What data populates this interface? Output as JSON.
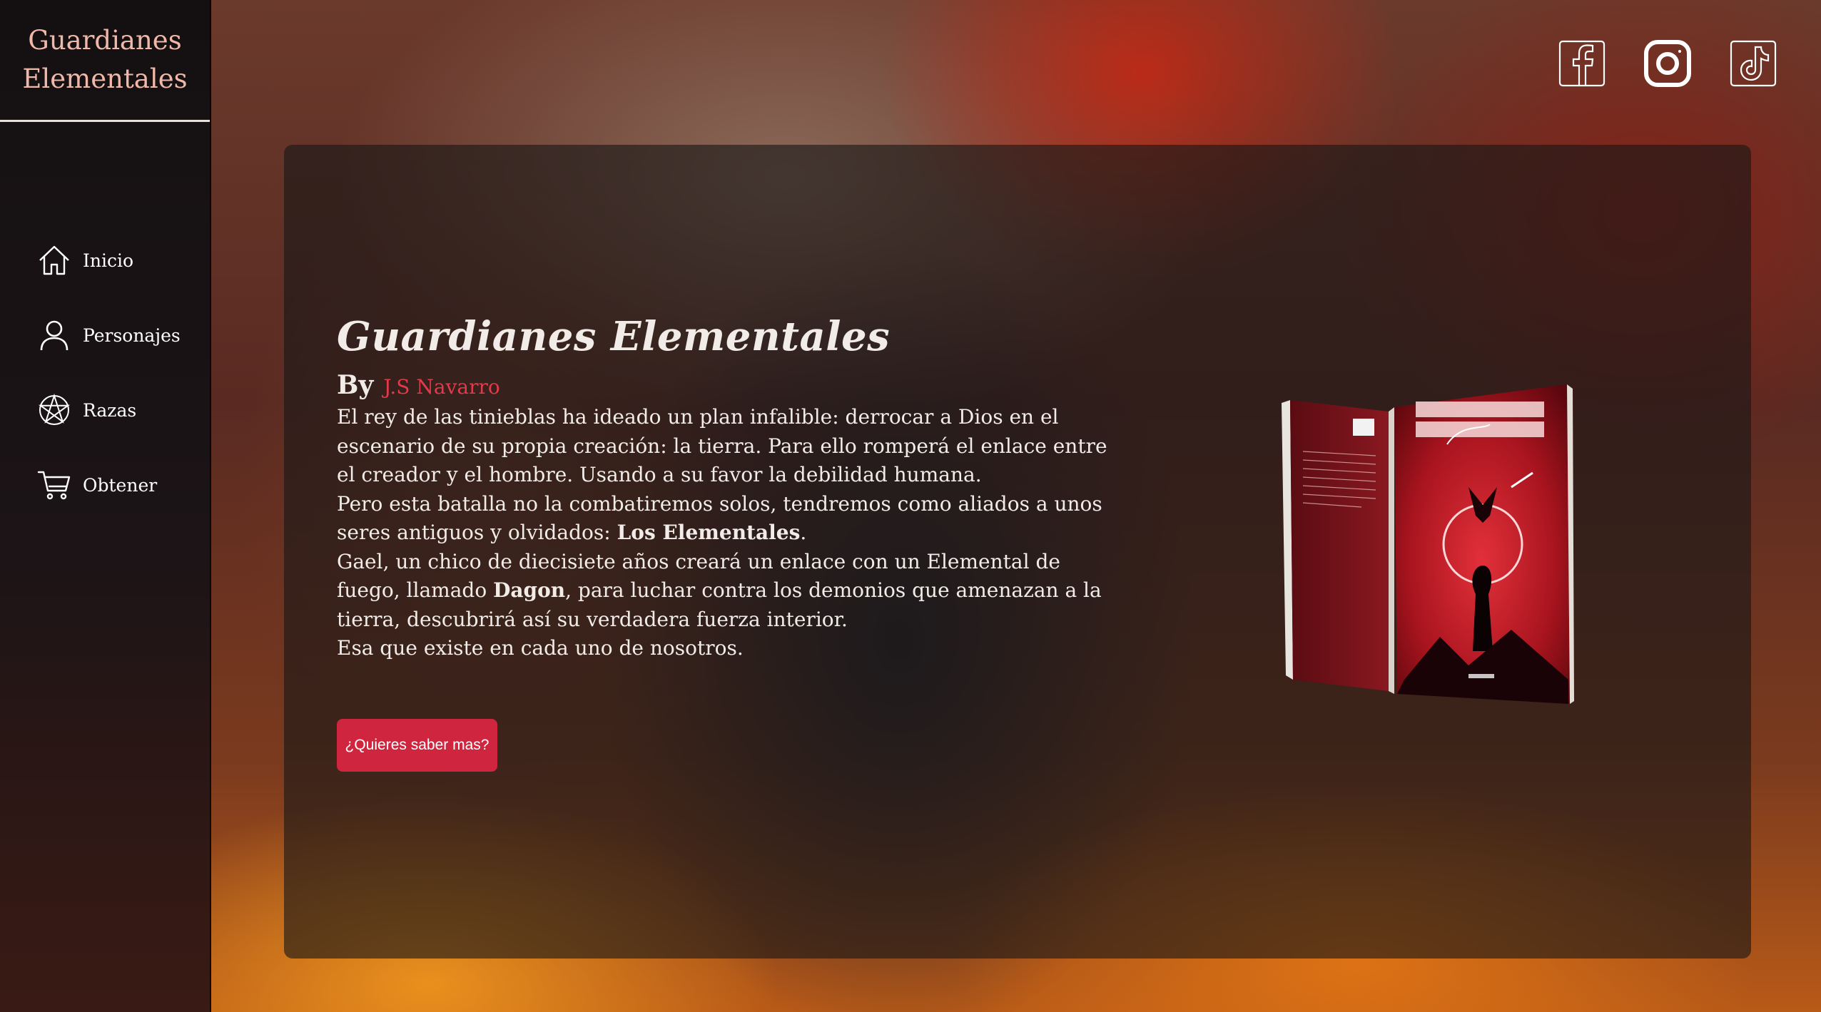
{
  "sidebar": {
    "logo_line1": "Guardianes",
    "logo_line2": "Elementales",
    "items": [
      {
        "label": "Inicio",
        "icon": "home-icon"
      },
      {
        "label": "Personajes",
        "icon": "user-icon"
      },
      {
        "label": "Razas",
        "icon": "pentagram-icon"
      },
      {
        "label": "Obtener",
        "icon": "cart-icon"
      }
    ]
  },
  "social": [
    {
      "icon": "facebook-icon"
    },
    {
      "icon": "instagram-icon"
    },
    {
      "icon": "tiktok-icon"
    }
  ],
  "main": {
    "title": "Guardianes Elementales",
    "by_label": "By",
    "author": "J.S Navarro",
    "description": {
      "p1": "El rey de las tinieblas ha ideado un plan infalible: derrocar a Dios en el escenario de su propia creación: la tierra. Para ello romperá el enlace entre el creador y el hombre. Usando a su favor la debilidad humana.",
      "p2_pre": "Pero esta batalla no la combatiremos solos, tendremos como aliados a unos seres antiguos y olvidados: ",
      "p2_bold": "Los Elementales",
      "p2_post": ".",
      "p3_pre": "Gael, un chico de diecisiete años creará un enlace con un Elemental de fuego, llamado ",
      "p3_bold": "Dagon",
      "p3_post": ", para luchar contra los demonios que amenazan a la tierra, descubrirá así su verdadera fuerza interior.",
      "p4": "Esa que existe en cada uno de nosotros."
    },
    "cta_label": "¿Quieres saber mas?"
  },
  "colors": {
    "accent": "#d0253f",
    "author": "#e23a4a",
    "logo": "#f0b8a8"
  }
}
